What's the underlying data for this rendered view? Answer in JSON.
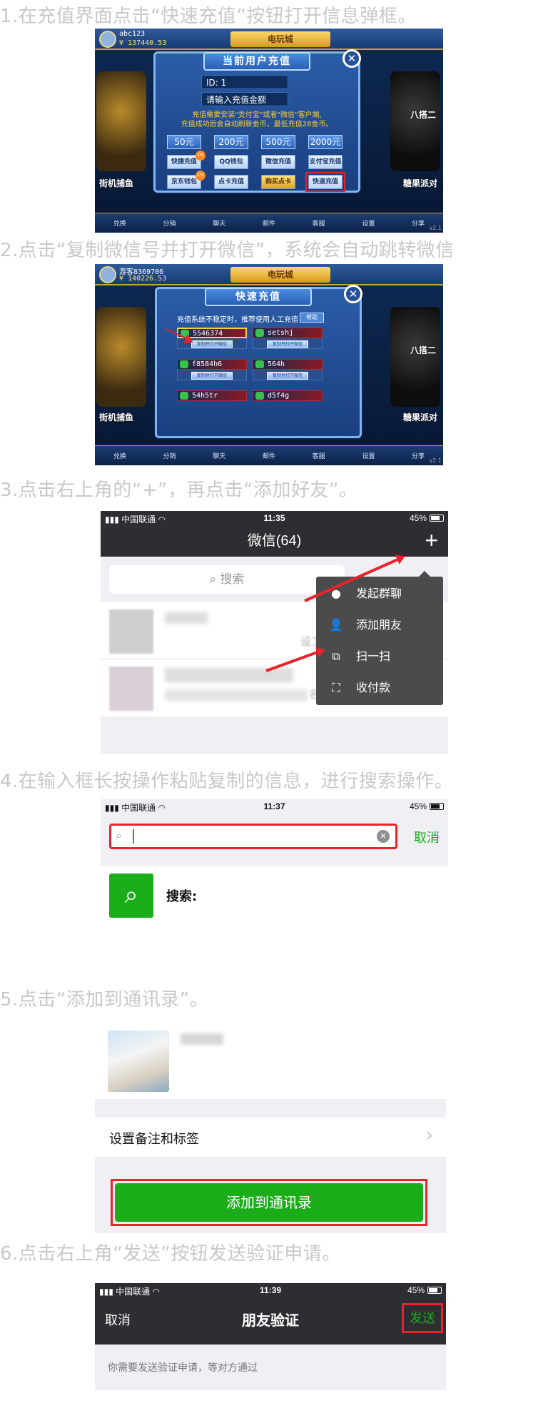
{
  "steps": [
    "1.在充值界面点击“快速充值”按钮打开信息弹框。",
    "2.点击“复制微信号并打开微信”，系统会自动跳转微信",
    "3.点击右上角的“+”，再点击“添加好友”。",
    "4.在输入框长按操作粘贴复制的信息，进行搜索操作。",
    "5.点击“添加到通讯录”。",
    "6.点击右上角“发送”按钮发送验证申请。"
  ],
  "shot1": {
    "user": "abc123",
    "coins": "¥ 137440.53",
    "banner": "电玩城",
    "side_left": "街机捕鱼",
    "side_right1": "八搭二",
    "side_right2": "糖果派对",
    "modal_title": "当前用户充值",
    "id_label": "ID: 1",
    "amount_placeholder": "请输入充值金额",
    "notice_line1": "充值需要安装\"支付宝\"或者\"微信\"客户端,",
    "notice_line2": "充值成功后会自动刷新金币，最低充值28金币。",
    "amounts": [
      "50元",
      "200元",
      "500元",
      "2000元"
    ],
    "pay1": [
      "快捷充值",
      "QQ钱包",
      "微信充值",
      "支付宝充值"
    ],
    "pay2": [
      "京东钱包",
      "点卡充值",
      "购买点卡",
      "快速充值"
    ],
    "bottom_tabs": [
      "兑换",
      "分销",
      "聊天",
      "邮件",
      "客服",
      "设置",
      "分享"
    ],
    "version": "v2.1"
  },
  "shot2": {
    "user": "游客8369706",
    "coins": "¥ 140226.53",
    "banner": "电玩城",
    "side_left": "街机捕鱼",
    "side_right1": "八搭二",
    "side_right2": "糖果派对",
    "modal_title": "快速充值",
    "notice": "充值系统不稳定时，推荐使用人工充值",
    "help": "帮助",
    "wechat_ids": [
      "5546374",
      "setshj",
      "f8584h6",
      "564h",
      "54h5tr",
      "d5f4g"
    ],
    "copy_btn": "复制并打开微信",
    "bottom_tabs": [
      "兑换",
      "分销",
      "聊天",
      "邮件",
      "客服",
      "设置",
      "分享"
    ],
    "version": "v2.1"
  },
  "shot3": {
    "carrier": "中国联通",
    "time": "11:35",
    "battery": "45%",
    "title": "微信(64)",
    "plus": "+",
    "search": "搜索",
    "menu": [
      "发起群聊",
      "添加朋友",
      "扫一扫",
      "收付款"
    ],
    "menu_icons": [
      "chat-bubble-icon",
      "add-friend-icon",
      "scan-icon",
      "payment-icon"
    ],
    "chat_snippet1": "设工作",
    "chat_snippet2": "名"
  },
  "shot4": {
    "carrier": "中国联通",
    "time": "11:37",
    "battery": "45%",
    "cancel": "取消",
    "result_label": "搜索:"
  },
  "shot5": {
    "remark": "设置备注和标签",
    "chevron": "›",
    "add_button": "添加到通讯录"
  },
  "shot6": {
    "carrier": "中国联通",
    "time": "11:39",
    "battery": "45%",
    "cancel": "取消",
    "title": "朋友验证",
    "send": "发送",
    "hint": "你需要发送验证申请，等对方通过"
  },
  "colors": {
    "wechat_green": "#1aad19",
    "red_highlight": "#e8232b",
    "step_text": "#c8c8c8"
  }
}
